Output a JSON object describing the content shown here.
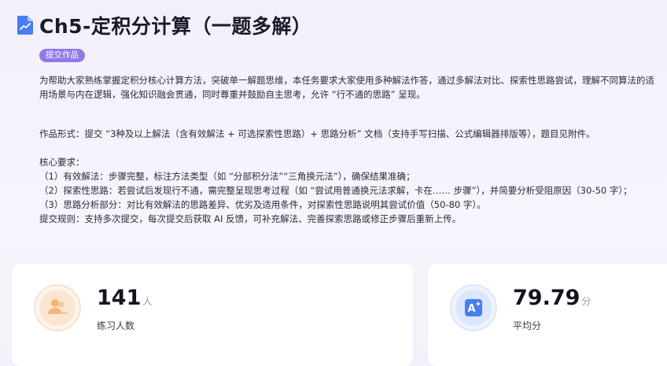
{
  "page": {
    "title": "Ch5-定积分计算（一题多解）",
    "badge": "提交作品"
  },
  "description": {
    "intro": "为帮助大家熟练掌握定积分核心计算方法，突破单一解题思维，本任务要求大家使用多种解法作答，通过多解法对比、探索性思路尝试，理解不同算法的适用场景与内在逻辑，强化知识融会贯通，同时尊重并鼓励自主思考，允许 “行不通的思路” 呈现。",
    "form": "作品形式：提交 “3种及以上解法（含有效解法 + 可选探索性思路）+ 思路分析” 文档（支持手写扫描、公式编辑器排版等），题目见附件。",
    "core_heading": "核心要求：",
    "core_items": [
      "（1）有效解法：步骤完整，标注方法类型（如 “分部积分法”“三角换元法”），确保结果准确；",
      "（2）探索性思路：若尝试后发现行不通，需完整呈现思考过程（如 “尝试用普通换元法求解，卡在…… 步骤”），并简要分析受阻原因（30-50 字）；",
      "（3）思路分析部分：对比有效解法的思路差异、优劣及适用条件，对探索性思路说明其尝试价值（50-80 字）。"
    ],
    "rules": "提交规则：支持多次提交，每次提交后获取 AI 反馈，可补充解法、完善探索思路或修正步骤后重新上传。"
  },
  "stats": {
    "practice": {
      "value": "141",
      "unit": "人",
      "label": "练习人数",
      "icon": "users-icon"
    },
    "average": {
      "value": "79.79",
      "unit": "分",
      "label": "平均分",
      "icon": "ai-score-icon"
    }
  },
  "colors": {
    "accent": "#9079e6",
    "title_icon": "#4a7df0",
    "users_icon": "#f2b57a",
    "score_icon": "#4a7df0"
  }
}
